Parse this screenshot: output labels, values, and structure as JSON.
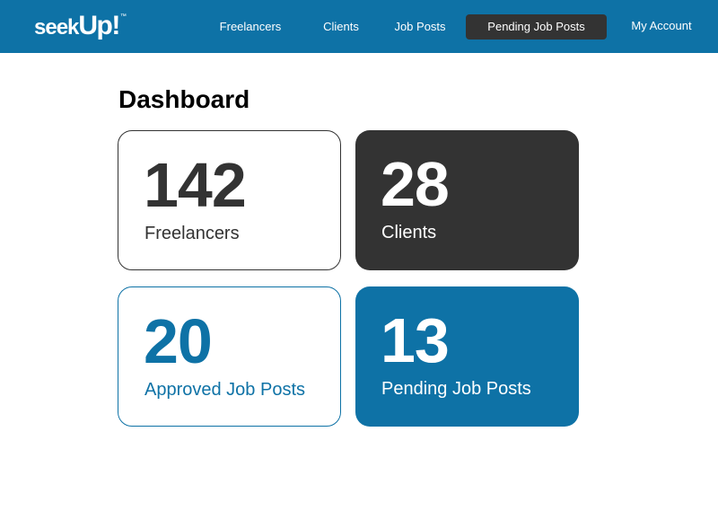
{
  "brand": {
    "logo_part1": "seek",
    "logo_part2": "Up!",
    "logo_mark": "™",
    "primary_color": "#0e72a6",
    "dark_color": "#333333"
  },
  "nav": {
    "items": [
      {
        "label": "Freelancers",
        "active": false
      },
      {
        "label": "Clients",
        "active": false
      },
      {
        "label": "Job Posts",
        "active": false
      },
      {
        "label": "Pending Job Posts",
        "active": true
      },
      {
        "label": "My Account",
        "active": false
      }
    ]
  },
  "main": {
    "title": "Dashboard",
    "cards": [
      {
        "value": "142",
        "label": "Freelancers"
      },
      {
        "value": "28",
        "label": "Clients"
      },
      {
        "value": "20",
        "label": "Approved Job Posts"
      },
      {
        "value": "13",
        "label": "Pending Job Posts"
      }
    ]
  }
}
